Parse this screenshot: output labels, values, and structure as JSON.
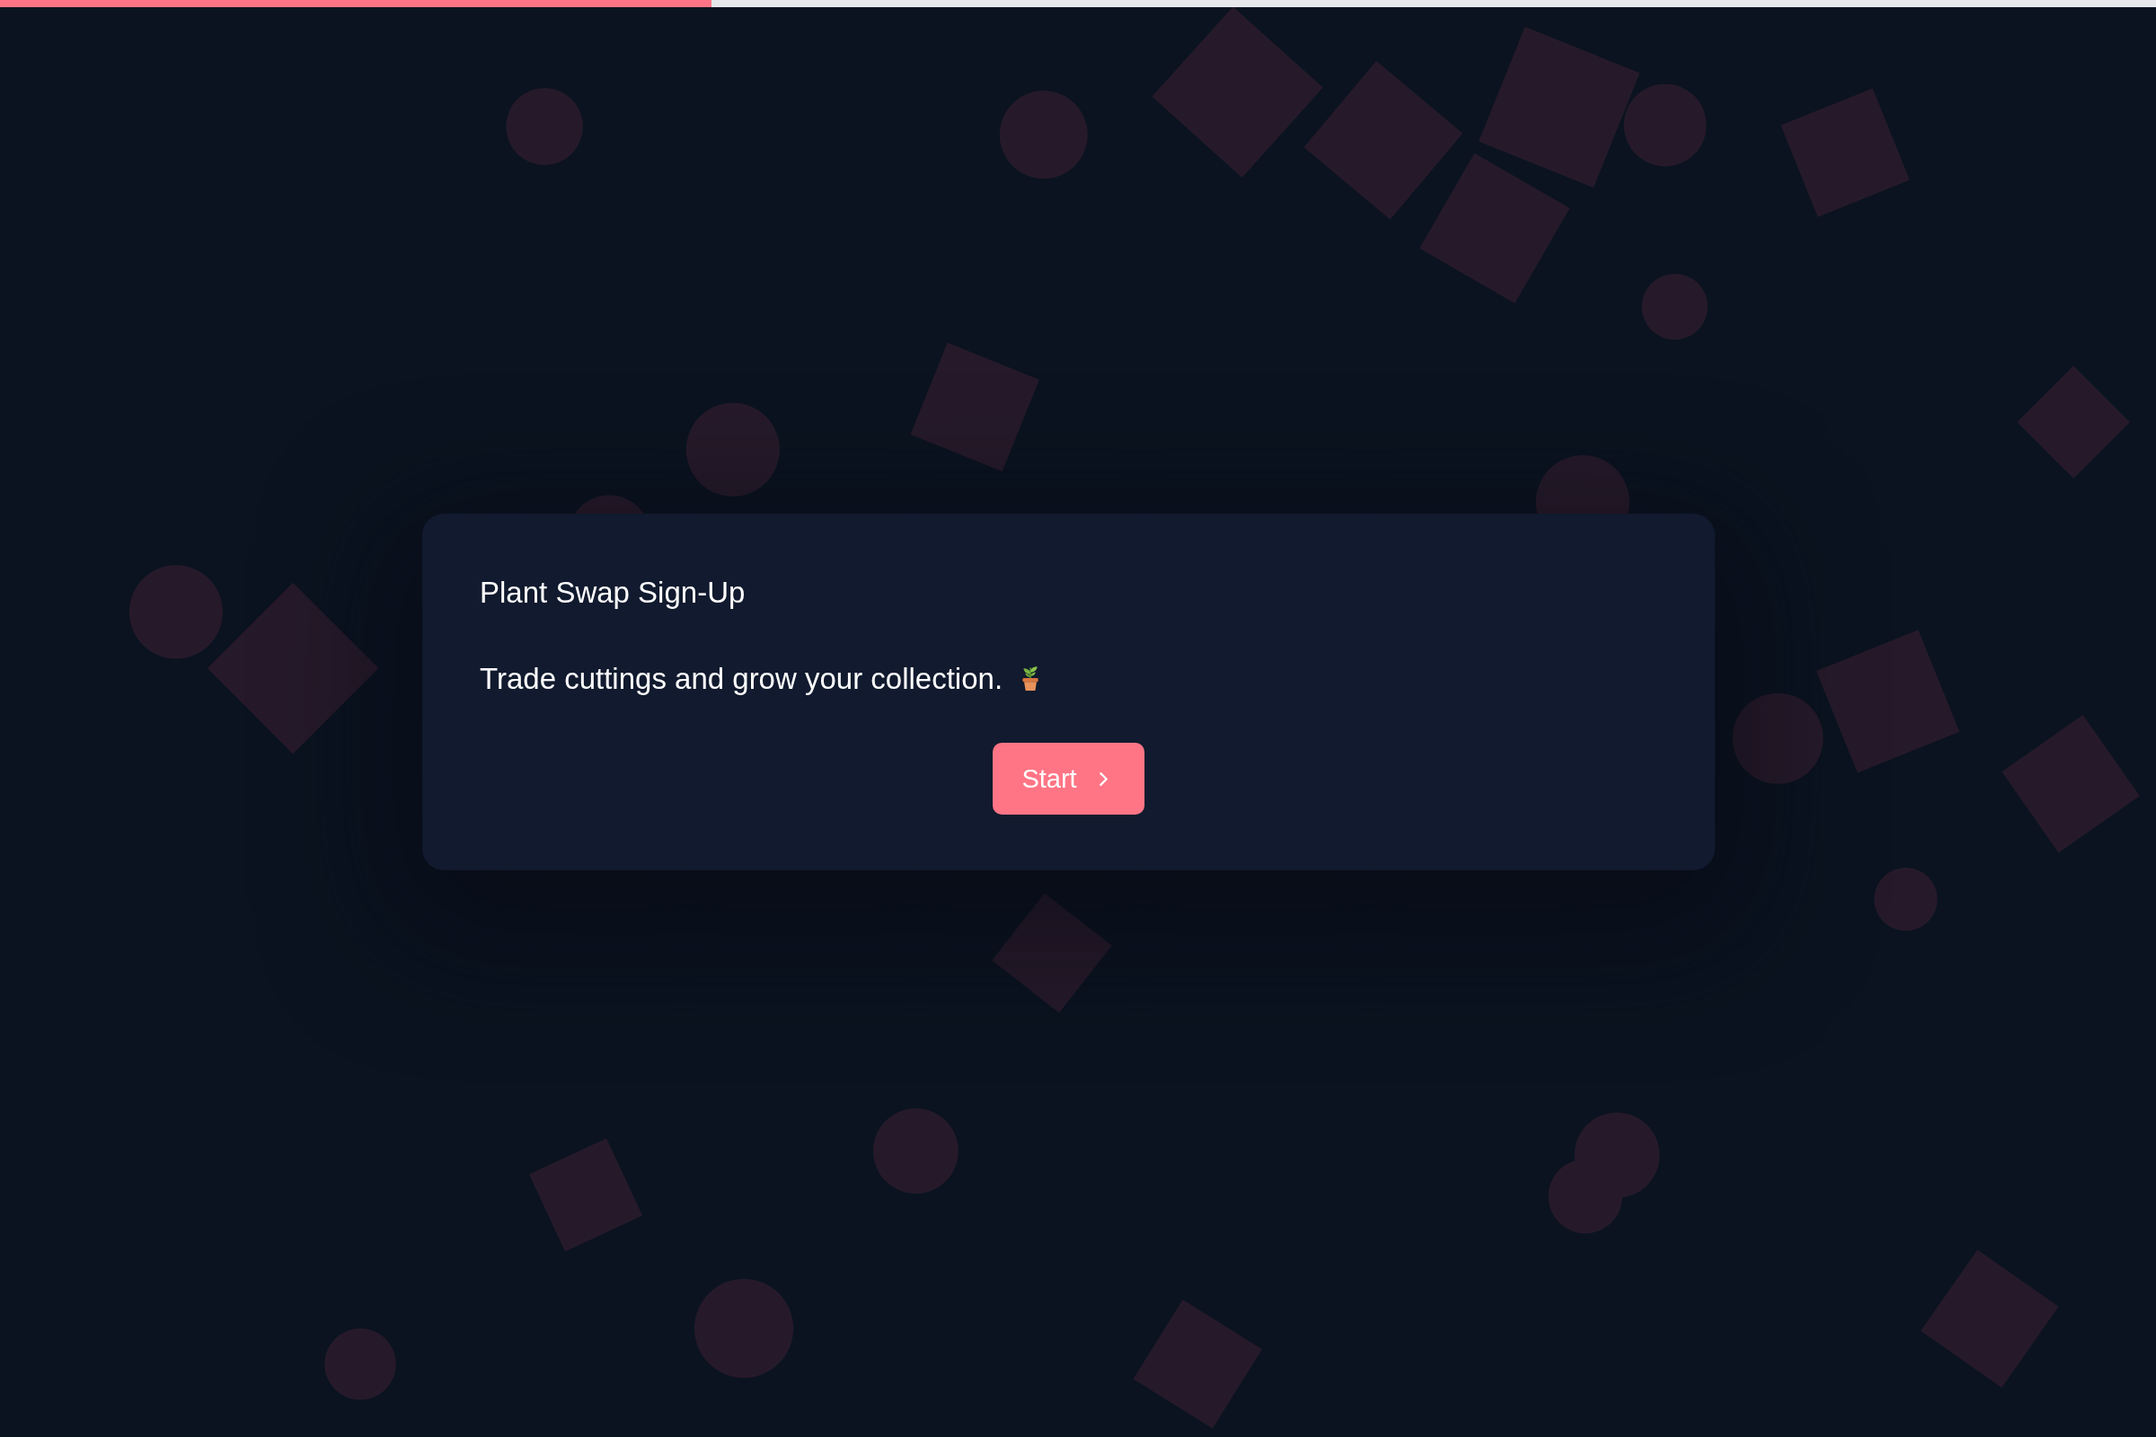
{
  "progress": {
    "level": 0.33
  },
  "card": {
    "title": "Plant Swap Sign-Up",
    "description": "Trade cuttings and grow your collection.",
    "button": "Start"
  }
}
